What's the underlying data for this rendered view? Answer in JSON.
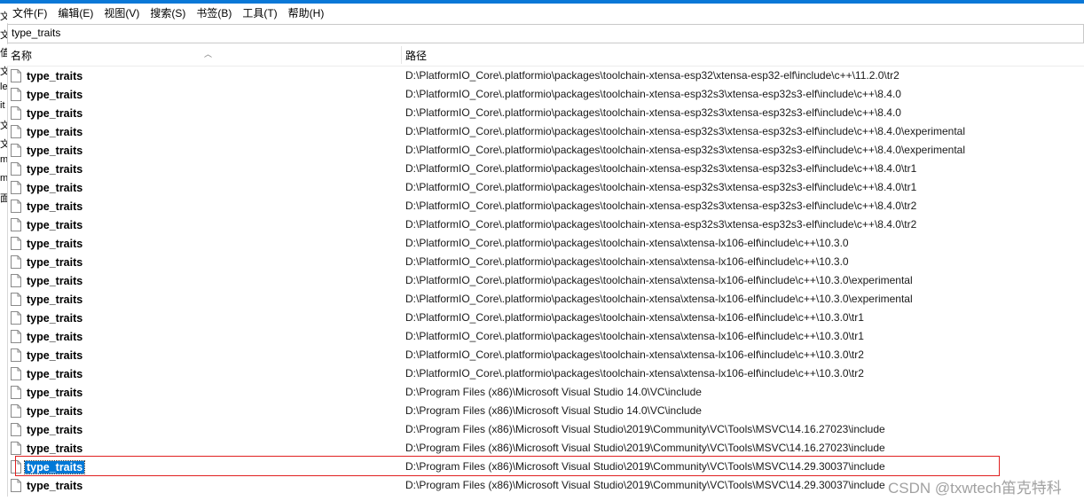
{
  "menubar": {
    "items": [
      "文件(F)",
      "编辑(E)",
      "视图(V)",
      "搜索(S)",
      "书签(B)",
      "工具(T)",
      "帮助(H)"
    ]
  },
  "search": {
    "value": "type_traits"
  },
  "left_strip": {
    "chars": [
      "文",
      "文",
      "值",
      "文",
      "le",
      "it",
      "文",
      "文",
      "m",
      "m",
      "面"
    ]
  },
  "columns": {
    "name": "名称",
    "path": "路径"
  },
  "rows": [
    {
      "name": "type_traits",
      "path": "D:\\PlatformIO_Core\\.platformio\\packages\\toolchain-xtensa-esp32\\xtensa-esp32-elf\\include\\c++\\11.2.0\\tr2"
    },
    {
      "name": "type_traits",
      "path": "D:\\PlatformIO_Core\\.platformio\\packages\\toolchain-xtensa-esp32s3\\xtensa-esp32s3-elf\\include\\c++\\8.4.0"
    },
    {
      "name": "type_traits",
      "path": "D:\\PlatformIO_Core\\.platformio\\packages\\toolchain-xtensa-esp32s3\\xtensa-esp32s3-elf\\include\\c++\\8.4.0"
    },
    {
      "name": "type_traits",
      "path": "D:\\PlatformIO_Core\\.platformio\\packages\\toolchain-xtensa-esp32s3\\xtensa-esp32s3-elf\\include\\c++\\8.4.0\\experimental"
    },
    {
      "name": "type_traits",
      "path": "D:\\PlatformIO_Core\\.platformio\\packages\\toolchain-xtensa-esp32s3\\xtensa-esp32s3-elf\\include\\c++\\8.4.0\\experimental"
    },
    {
      "name": "type_traits",
      "path": "D:\\PlatformIO_Core\\.platformio\\packages\\toolchain-xtensa-esp32s3\\xtensa-esp32s3-elf\\include\\c++\\8.4.0\\tr1"
    },
    {
      "name": "type_traits",
      "path": "D:\\PlatformIO_Core\\.platformio\\packages\\toolchain-xtensa-esp32s3\\xtensa-esp32s3-elf\\include\\c++\\8.4.0\\tr1"
    },
    {
      "name": "type_traits",
      "path": "D:\\PlatformIO_Core\\.platformio\\packages\\toolchain-xtensa-esp32s3\\xtensa-esp32s3-elf\\include\\c++\\8.4.0\\tr2"
    },
    {
      "name": "type_traits",
      "path": "D:\\PlatformIO_Core\\.platformio\\packages\\toolchain-xtensa-esp32s3\\xtensa-esp32s3-elf\\include\\c++\\8.4.0\\tr2"
    },
    {
      "name": "type_traits",
      "path": "D:\\PlatformIO_Core\\.platformio\\packages\\toolchain-xtensa\\xtensa-lx106-elf\\include\\c++\\10.3.0"
    },
    {
      "name": "type_traits",
      "path": "D:\\PlatformIO_Core\\.platformio\\packages\\toolchain-xtensa\\xtensa-lx106-elf\\include\\c++\\10.3.0"
    },
    {
      "name": "type_traits",
      "path": "D:\\PlatformIO_Core\\.platformio\\packages\\toolchain-xtensa\\xtensa-lx106-elf\\include\\c++\\10.3.0\\experimental"
    },
    {
      "name": "type_traits",
      "path": "D:\\PlatformIO_Core\\.platformio\\packages\\toolchain-xtensa\\xtensa-lx106-elf\\include\\c++\\10.3.0\\experimental"
    },
    {
      "name": "type_traits",
      "path": "D:\\PlatformIO_Core\\.platformio\\packages\\toolchain-xtensa\\xtensa-lx106-elf\\include\\c++\\10.3.0\\tr1"
    },
    {
      "name": "type_traits",
      "path": "D:\\PlatformIO_Core\\.platformio\\packages\\toolchain-xtensa\\xtensa-lx106-elf\\include\\c++\\10.3.0\\tr1"
    },
    {
      "name": "type_traits",
      "path": "D:\\PlatformIO_Core\\.platformio\\packages\\toolchain-xtensa\\xtensa-lx106-elf\\include\\c++\\10.3.0\\tr2"
    },
    {
      "name": "type_traits",
      "path": "D:\\PlatformIO_Core\\.platformio\\packages\\toolchain-xtensa\\xtensa-lx106-elf\\include\\c++\\10.3.0\\tr2"
    },
    {
      "name": "type_traits",
      "path": "D:\\Program Files (x86)\\Microsoft Visual Studio 14.0\\VC\\include"
    },
    {
      "name": "type_traits",
      "path": "D:\\Program Files (x86)\\Microsoft Visual Studio 14.0\\VC\\include"
    },
    {
      "name": "type_traits",
      "path": "D:\\Program Files (x86)\\Microsoft Visual Studio\\2019\\Community\\VC\\Tools\\MSVC\\14.16.27023\\include"
    },
    {
      "name": "type_traits",
      "path": "D:\\Program Files (x86)\\Microsoft Visual Studio\\2019\\Community\\VC\\Tools\\MSVC\\14.16.27023\\include"
    },
    {
      "name": "type_traits",
      "path": "D:\\Program Files (x86)\\Microsoft Visual Studio\\2019\\Community\\VC\\Tools\\MSVC\\14.29.30037\\include",
      "selected": true
    },
    {
      "name": "type_traits",
      "path": "D:\\Program Files (x86)\\Microsoft Visual Studio\\2019\\Community\\VC\\Tools\\MSVC\\14.29.30037\\include"
    }
  ],
  "watermark": "CSDN @txwtech笛克特科",
  "colors": {
    "selection": "#0078d7",
    "highlight_box": "#e02020",
    "accent": "#0a78d7"
  }
}
